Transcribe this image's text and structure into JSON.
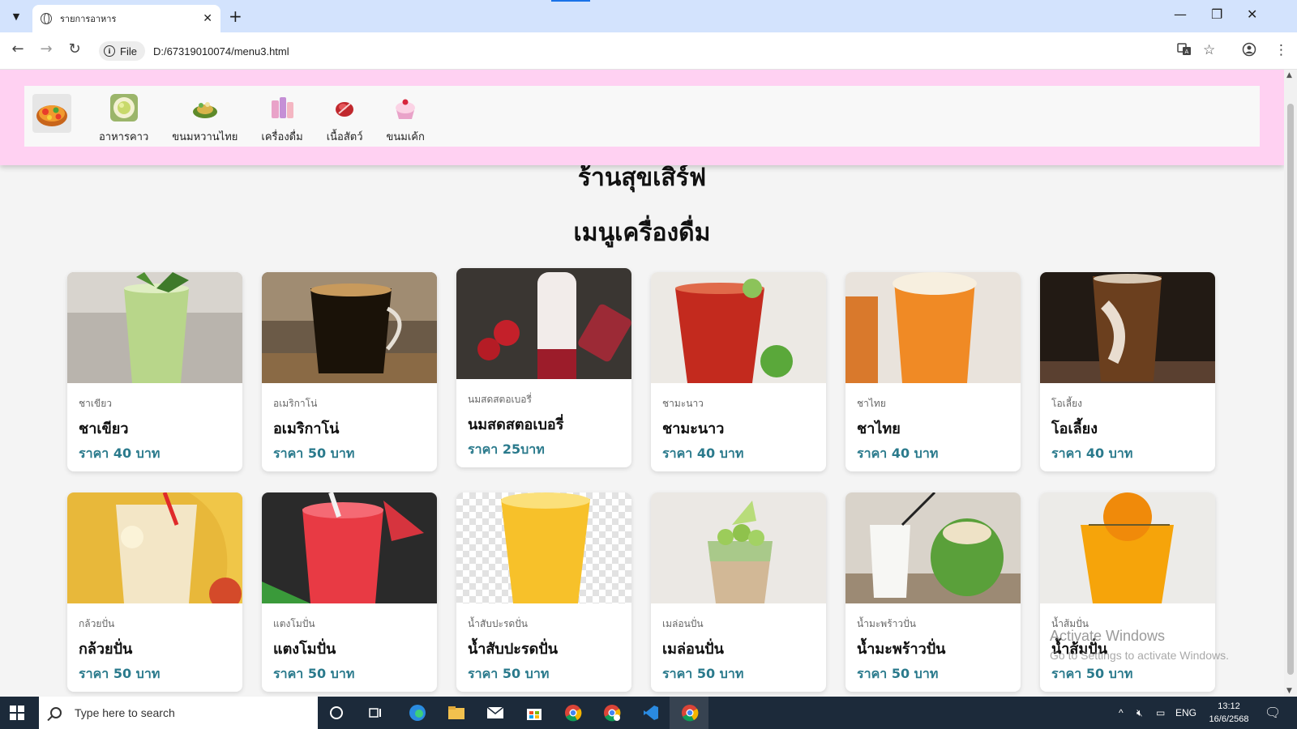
{
  "browser": {
    "tab_title": "รายการอาหาร",
    "new_tab_symbol": "+",
    "close_symbol": "✕",
    "security_chip": "File",
    "url": "D:/67319010074/menu3.html"
  },
  "nav": {
    "items": [
      {
        "label": "อาหารคาว",
        "icon": "savory-food-icon"
      },
      {
        "label": "ขนมหวานไทย",
        "icon": "thai-dessert-icon"
      },
      {
        "label": "เครื่องดื่ม",
        "icon": "drinks-icon"
      },
      {
        "label": "เนื้อสัตว์",
        "icon": "meat-icon"
      },
      {
        "label": "ขนมเค้ก",
        "icon": "cake-icon"
      }
    ]
  },
  "page": {
    "shop_name": "ร้านสุขเสิร์ฟ",
    "menu_title": "เมนูเครื่องดื่ม"
  },
  "menu": [
    {
      "sub": "ชาเขียว",
      "name": "ชาเขียว",
      "price": "ราคา 40 บาท"
    },
    {
      "sub": "อเมริกาโน่",
      "name": "อเมริกาโน่",
      "price": "ราคา 50 บาท"
    },
    {
      "sub": "นมสดสตอเบอรี่",
      "name": "นมสดสตอเบอรี่",
      "price": "ราคา 25บาท"
    },
    {
      "sub": "ชามะนาว",
      "name": "ชามะนาว",
      "price": "ราคา 40 บาท"
    },
    {
      "sub": "ชาไทย",
      "name": "ชาไทย",
      "price": "ราคา 40 บาท"
    },
    {
      "sub": "โอเลี้ยง",
      "name": "โอเลี้ยง",
      "price": "ราคา 40 บาท"
    },
    {
      "sub": "กล้วยปั่น",
      "name": "กล้วยปั่น",
      "price": "ราคา 50 บาท"
    },
    {
      "sub": "แตงโมปั่น",
      "name": "แตงโมปั่น",
      "price": "ราคา 50 บาท"
    },
    {
      "sub": "น้ำสับปะรดปั่น",
      "name": "น้ำสับปะรดปั่น",
      "price": "ราคา 50 บาท"
    },
    {
      "sub": "เมล่อนปั่น",
      "name": "เมล่อนปั่น",
      "price": "ราคา 50 บาท"
    },
    {
      "sub": "น้ำมะพร้าวปั่น",
      "name": "น้ำมะพร้าวปั่น",
      "price": "ราคา 50 บาท"
    },
    {
      "sub": "น้ำส้มปั่น",
      "name": "น้ำส้มปั่น",
      "price": "ราคา 50 บาท"
    }
  ],
  "watermark": {
    "line1": "Activate Windows",
    "line2": "Go to Settings to activate Windows."
  },
  "taskbar": {
    "search_placeholder": "Type here to search",
    "lang": "ENG",
    "time": "13:12",
    "date": "16/6/2568"
  },
  "colors": {
    "header_bg": "#ffd1f2",
    "price_text": "#2a7a8c",
    "taskbar_bg": "#1c2a3a"
  }
}
